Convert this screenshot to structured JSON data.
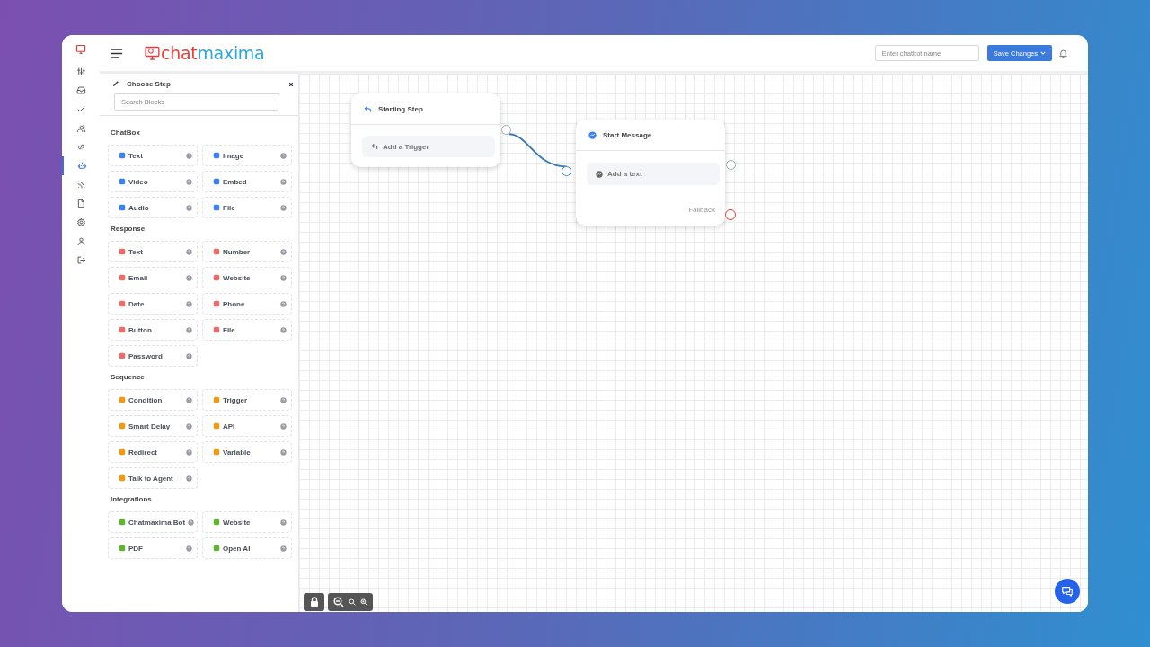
{
  "brand": {
    "first": "chat",
    "second": "maxima"
  },
  "rail": [
    {
      "selected": false
    },
    {
      "selected": false
    },
    {
      "selected": false
    },
    {
      "selected": false
    },
    {
      "selected": false
    },
    {
      "selected": true
    },
    {
      "selected": false
    },
    {
      "selected": false
    },
    {
      "selected": false
    },
    {
      "selected": false
    },
    {
      "selected": false
    }
  ],
  "header": {
    "name_placeholder": "Enter chatbot name",
    "save_button": "Save Changes"
  },
  "panel": {
    "title": "Choose Step",
    "search_placeholder": "Search Blocks",
    "sections": [
      {
        "title": "ChatBox",
        "color": "#3b82f6",
        "items": [
          {
            "label": "Text"
          },
          {
            "label": "Image"
          },
          {
            "label": "Video"
          },
          {
            "label": "Embed"
          },
          {
            "label": "Audio"
          },
          {
            "label": "File"
          }
        ]
      },
      {
        "title": "Response",
        "color": "#f06a6a",
        "items": [
          {
            "label": "Text"
          },
          {
            "label": "Number"
          },
          {
            "label": "Email"
          },
          {
            "label": "Website"
          },
          {
            "label": "Date"
          },
          {
            "label": "Phone"
          },
          {
            "label": "Button"
          },
          {
            "label": "File"
          },
          {
            "label": "Password"
          }
        ]
      },
      {
        "title": "Sequence",
        "color": "#f29a0e",
        "items": [
          {
            "label": "Condition"
          },
          {
            "label": "Trigger"
          },
          {
            "label": "Smart Delay"
          },
          {
            "label": "API"
          },
          {
            "label": "Redirect"
          },
          {
            "label": "Variable"
          },
          {
            "label": "Talk to Agent"
          }
        ]
      },
      {
        "title": "Integrations",
        "color": "#5cb82a",
        "items": [
          {
            "label": "Chatmaxima Bot"
          },
          {
            "label": "Website"
          },
          {
            "label": "PDF"
          },
          {
            "label": "Open AI"
          }
        ]
      }
    ]
  },
  "canvas": {
    "nodes": [
      {
        "title": "Starting Step",
        "action": "Add a Trigger"
      },
      {
        "title": "Start Message",
        "action": "Add a text",
        "fallback": "Fallback"
      }
    ]
  }
}
